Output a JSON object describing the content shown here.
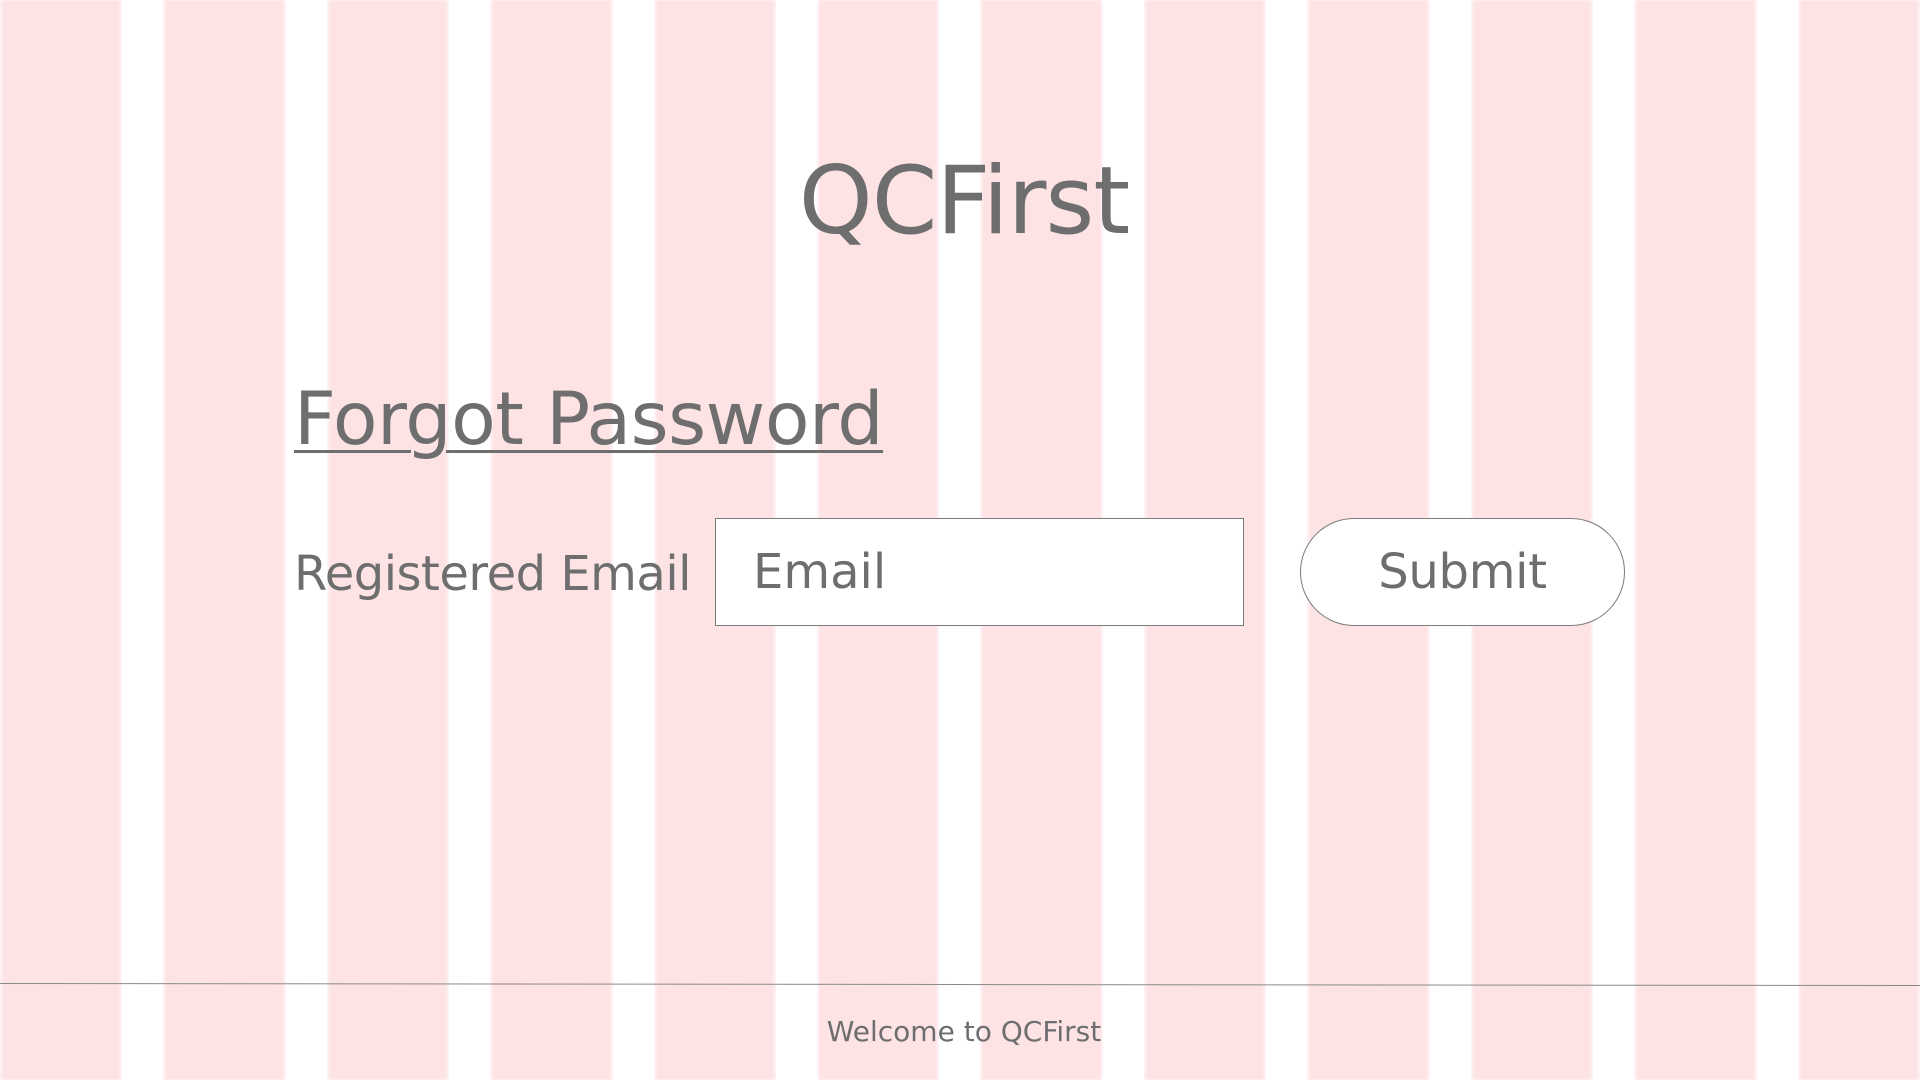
{
  "app": {
    "title": "QCFirst"
  },
  "page": {
    "heading": "Forgot Password"
  },
  "form": {
    "email_label": "Registered Email",
    "email_value": "",
    "email_placeholder": "Email",
    "submit_label": "Submit"
  },
  "footer": {
    "text": "Welcome to QCFirst"
  },
  "colors": {
    "text": "#6e6e6e",
    "grid_column": "#fee3e5",
    "border": "#7a7a7a",
    "background": "#ffffff"
  }
}
